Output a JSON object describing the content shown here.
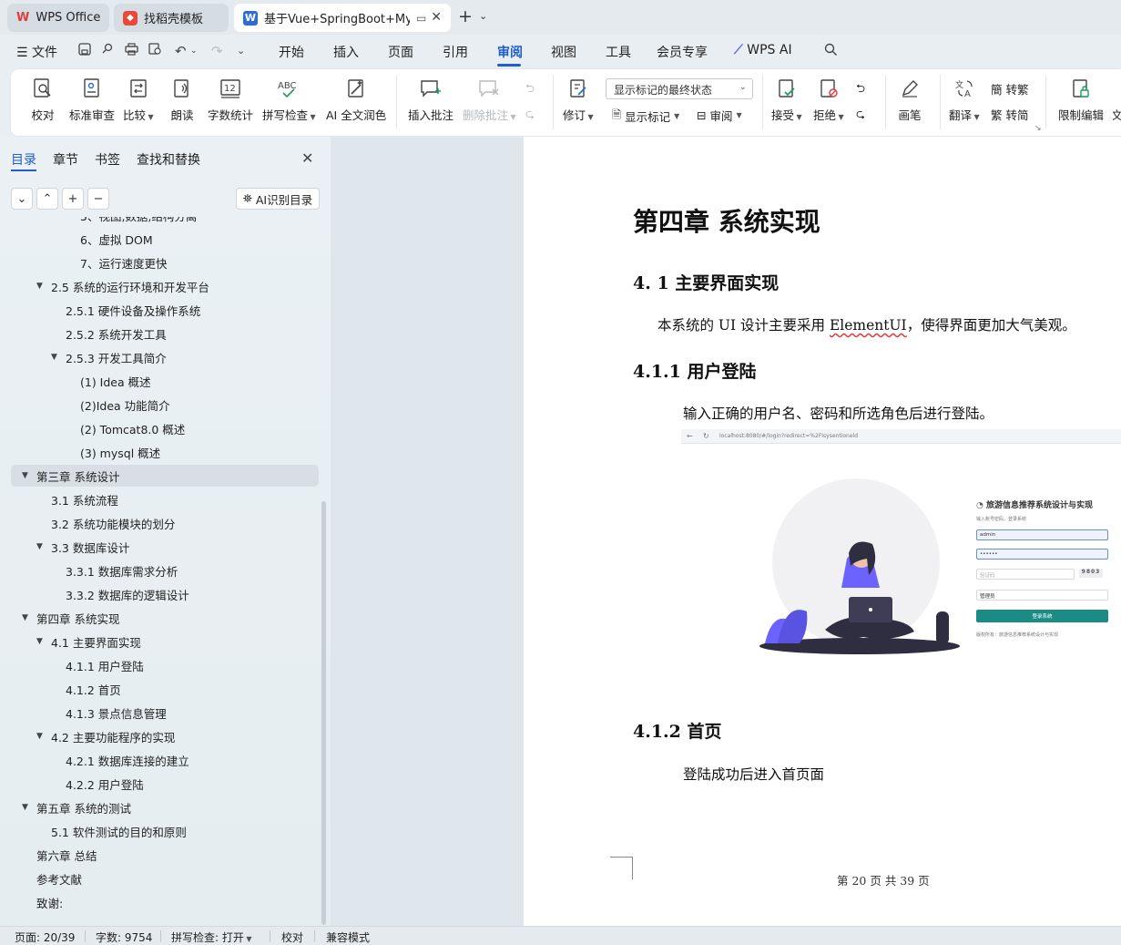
{
  "tabs": [
    {
      "label": "WPS Office",
      "active": false
    },
    {
      "label": "找稻壳模板",
      "active": false
    },
    {
      "label": "基于Vue+SpringBoot+MySQ",
      "active": true
    }
  ],
  "menu": {
    "file": "文件",
    "items": [
      "开始",
      "插入",
      "页面",
      "引用",
      "审阅",
      "视图",
      "工具",
      "会员专享"
    ],
    "selected": "审阅",
    "wps_ai": "WPS AI"
  },
  "ribbon": {
    "proofread": "校对",
    "standard_review": "标准审查",
    "compare": "比较",
    "read_aloud": "朗读",
    "word_count": "字数统计",
    "spell_check": "拼写检查",
    "ai_polish": "AI 全文润色",
    "insert_comment": "插入批注",
    "delete_comment": "删除批注",
    "revise": "修订",
    "markup_state": "显示标记的最终状态",
    "show_markup": "显示标记",
    "review": "审阅",
    "accept": "接受",
    "reject": "拒绝",
    "pen": "画笔",
    "translate": "翻译",
    "to_traditional": "转繁",
    "to_simplified": "转简",
    "restrict_edit": "限制编辑",
    "doc_cut": "文"
  },
  "nav": {
    "tabs": [
      "目录",
      "章节",
      "书签",
      "查找和替换"
    ],
    "selected_tab": "目录",
    "ai_toc": "AI识别目录",
    "toc": [
      {
        "label": "5、视图,数据,结构分离",
        "level": 3,
        "caret": ""
      },
      {
        "label": "6、虚拟 DOM",
        "level": 3,
        "caret": ""
      },
      {
        "label": "7、运行速度更快",
        "level": 3,
        "caret": ""
      },
      {
        "label": "2.5  系统的运行环境和开发平台",
        "level": 1,
        "caret": "▼"
      },
      {
        "label": "2.5.1  硬件设备及操作系统",
        "level": 2,
        "caret": ""
      },
      {
        "label": "2.5.2  系统开发工具",
        "level": 2,
        "caret": ""
      },
      {
        "label": "2.5.3  开发工具简介",
        "level": 2,
        "caret": "▼"
      },
      {
        "label": "(1) Idea 概述",
        "level": 3,
        "caret": ""
      },
      {
        "label": "(2)Idea 功能简介",
        "level": 3,
        "caret": ""
      },
      {
        "label": "(2) Tomcat8.0 概述",
        "level": 3,
        "caret": ""
      },
      {
        "label": "(3) mysql 概述",
        "level": 3,
        "caret": ""
      },
      {
        "label": "第三章  系统设计",
        "level": 0,
        "caret": "▼",
        "highlight": true
      },
      {
        "label": "3.1 系统流程",
        "level": 1,
        "caret": ""
      },
      {
        "label": "3.2  系统功能模块的划分",
        "level": 1,
        "caret": ""
      },
      {
        "label": "3.3 数据库设计",
        "level": 1,
        "caret": "▼"
      },
      {
        "label": "3.3.1 数据库需求分析",
        "level": 2,
        "caret": ""
      },
      {
        "label": "3.3.2 数据库的逻辑设计",
        "level": 2,
        "caret": ""
      },
      {
        "label": "第四章  系统实现",
        "level": 0,
        "caret": "▼"
      },
      {
        "label": "4.1 主要界面实现",
        "level": 1,
        "caret": "▼"
      },
      {
        "label": "4.1.1 用户登陆",
        "level": 2,
        "caret": ""
      },
      {
        "label": "4.1.2  首页",
        "level": 2,
        "caret": ""
      },
      {
        "label": "4.1.3  景点信息管理",
        "level": 2,
        "caret": ""
      },
      {
        "label": "4.2 主要功能程序的实现",
        "level": 1,
        "caret": "▼"
      },
      {
        "label": "4.2.1  数据库连接的建立",
        "level": 2,
        "caret": ""
      },
      {
        "label": "4.2.2 用户登陆",
        "level": 2,
        "caret": ""
      },
      {
        "label": "第五章  系统的测试",
        "level": 0,
        "caret": "▼"
      },
      {
        "label": "5.1    软件测试的目的和原则",
        "level": 1,
        "caret": ""
      },
      {
        "label": "第六章    总结",
        "level": 0,
        "caret": ""
      },
      {
        "label": "参考文献",
        "level": 0,
        "caret": ""
      },
      {
        "label": "致谢:",
        "level": 0,
        "caret": ""
      }
    ]
  },
  "doc": {
    "chapter_title": "第四章  系统实现",
    "h_4_1": "4. 1 主要界面实现",
    "p_intro_pre": "本系统的 UI 设计主要采用 ",
    "p_intro_word": "ElementUI",
    "p_intro_post": "，使得界面更加大气美观。",
    "h_4_1_1": "4.1.1 用户登陆",
    "p_login": "输入正确的用户名、密码和所选角色后进行登陆。",
    "h_4_1_2": "4.1.2  首页",
    "p_home": "登陆成功后进入首页面",
    "footer": "第  20  页  共  39  页"
  },
  "screenshot": {
    "url": "localhost:8080/#/login?redirect=%2FIsysentioneld",
    "title": "旅游信息推荐系统设计与实现",
    "subtitle": "输入账号密码，登录系统",
    "username": "admin",
    "password": "••••••",
    "captcha_placeholder": "验证码",
    "captcha": "9803",
    "role": "管理员",
    "login_button": "登录系统",
    "footer": "版权所有：旅游信息推荐系统设计与实现"
  },
  "status": {
    "page": "页面: 20/39",
    "word_count": "字数: 9754",
    "spell_check": "拼写检查: 打开",
    "proofread": "校对",
    "compat_mode": "兼容模式"
  },
  "colors": {
    "accent": "#1f5dd0",
    "login_button": "#1b8b86",
    "illustration_purple": "#6c63ff"
  }
}
